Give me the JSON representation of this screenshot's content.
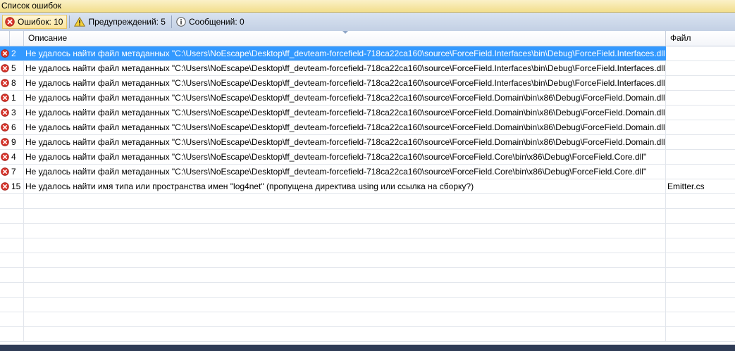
{
  "window": {
    "title": "Список ошибок"
  },
  "toolbar": {
    "errors_label": "Ошибок: 10",
    "warnings_label": "Предупреждений: 5",
    "messages_label": "Сообщений: 0"
  },
  "columns": {
    "description": "Описание",
    "file": "Файл"
  },
  "rows": [
    {
      "num": "2",
      "desc": "Не удалось найти файл метаданных \"C:\\Users\\NoEscape\\Desktop\\ff_devteam-forcefield-718ca22ca160\\source\\ForceField.Interfaces\\bin\\Debug\\ForceField.Interfaces.dll\"",
      "file": ""
    },
    {
      "num": "5",
      "desc": "Не удалось найти файл метаданных \"C:\\Users\\NoEscape\\Desktop\\ff_devteam-forcefield-718ca22ca160\\source\\ForceField.Interfaces\\bin\\Debug\\ForceField.Interfaces.dll\"",
      "file": ""
    },
    {
      "num": "8",
      "desc": "Не удалось найти файл метаданных \"C:\\Users\\NoEscape\\Desktop\\ff_devteam-forcefield-718ca22ca160\\source\\ForceField.Interfaces\\bin\\Debug\\ForceField.Interfaces.dll\"",
      "file": ""
    },
    {
      "num": "1",
      "desc": "Не удалось найти файл метаданных \"C:\\Users\\NoEscape\\Desktop\\ff_devteam-forcefield-718ca22ca160\\source\\ForceField.Domain\\bin\\x86\\Debug\\ForceField.Domain.dll\"",
      "file": ""
    },
    {
      "num": "3",
      "desc": "Не удалось найти файл метаданных \"C:\\Users\\NoEscape\\Desktop\\ff_devteam-forcefield-718ca22ca160\\source\\ForceField.Domain\\bin\\x86\\Debug\\ForceField.Domain.dll\"",
      "file": ""
    },
    {
      "num": "6",
      "desc": "Не удалось найти файл метаданных \"C:\\Users\\NoEscape\\Desktop\\ff_devteam-forcefield-718ca22ca160\\source\\ForceField.Domain\\bin\\x86\\Debug\\ForceField.Domain.dll\"",
      "file": ""
    },
    {
      "num": "9",
      "desc": "Не удалось найти файл метаданных \"C:\\Users\\NoEscape\\Desktop\\ff_devteam-forcefield-718ca22ca160\\source\\ForceField.Domain\\bin\\x86\\Debug\\ForceField.Domain.dll\"",
      "file": ""
    },
    {
      "num": "4",
      "desc": "Не удалось найти файл метаданных \"C:\\Users\\NoEscape\\Desktop\\ff_devteam-forcefield-718ca22ca160\\source\\ForceField.Core\\bin\\x86\\Debug\\ForceField.Core.dll\"",
      "file": ""
    },
    {
      "num": "7",
      "desc": "Не удалось найти файл метаданных \"C:\\Users\\NoEscape\\Desktop\\ff_devteam-forcefield-718ca22ca160\\source\\ForceField.Core\\bin\\x86\\Debug\\ForceField.Core.dll\"",
      "file": ""
    },
    {
      "num": "15",
      "desc": "Не удалось найти имя типа или пространства имен \"log4net\" (пропущена директива using или ссылка на сборку?)",
      "file": "Emitter.cs"
    }
  ],
  "colors": {
    "selection": "#3399ff",
    "error_icon": "#d9342b",
    "title_bar": "#f2de8c",
    "toolbar": "#c3d0e4"
  }
}
